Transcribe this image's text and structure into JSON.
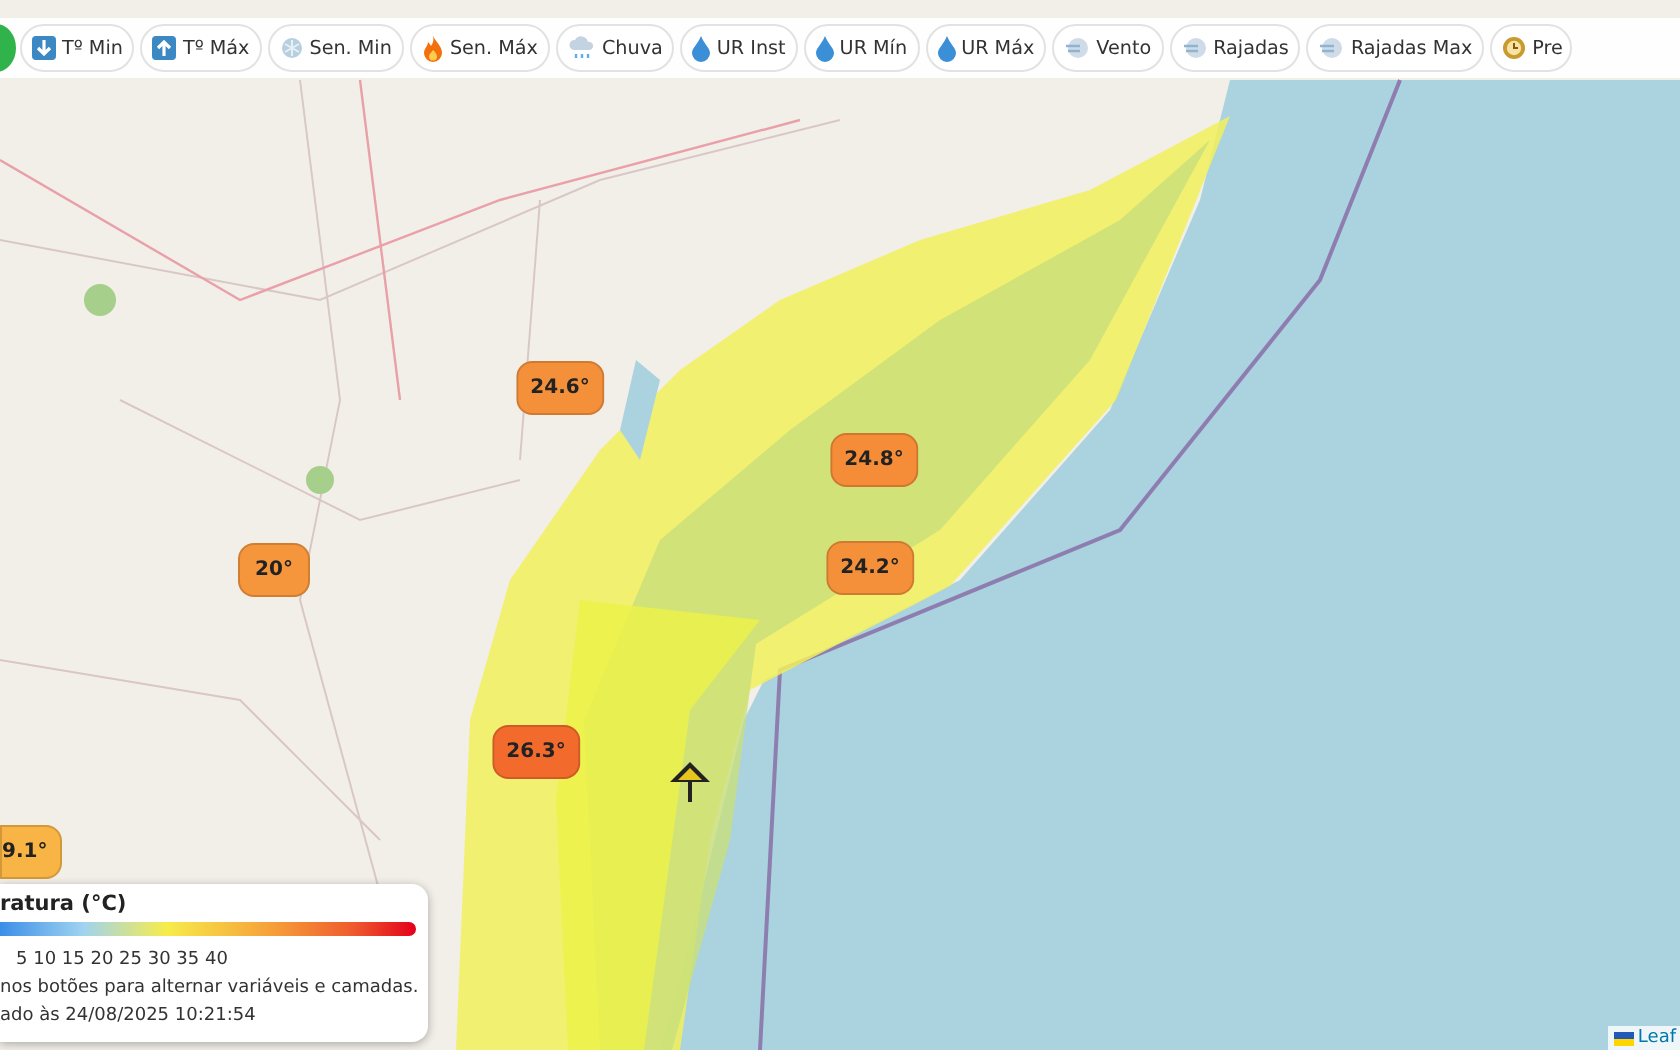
{
  "toolbar": {
    "buttons": [
      {
        "label": "Tº Min",
        "kind": "arrow-down"
      },
      {
        "label": "Tº Máx",
        "kind": "arrow-up"
      },
      {
        "label": "Sen. Min",
        "kind": "snow"
      },
      {
        "label": "Sen. Máx",
        "kind": "fire"
      },
      {
        "label": "Chuva",
        "kind": "rain"
      },
      {
        "label": "UR Inst",
        "kind": "drop"
      },
      {
        "label": "UR Mín",
        "kind": "drop"
      },
      {
        "label": "UR Máx",
        "kind": "drop"
      },
      {
        "label": "Vento",
        "kind": "wind"
      },
      {
        "label": "Rajadas",
        "kind": "wind"
      },
      {
        "label": "Rajadas Max",
        "kind": "wind"
      },
      {
        "label": "Pre",
        "kind": "clock"
      }
    ]
  },
  "markers": [
    {
      "label": "24.6°",
      "color": "#f5903a"
    },
    {
      "label": "24.8°",
      "color": "#f58c38"
    },
    {
      "label": "20°",
      "color": "#f5953c"
    },
    {
      "label": "24.2°",
      "color": "#f5903a"
    },
    {
      "label": "26.3°",
      "color": "#f26a2c"
    },
    {
      "label": "9.1°",
      "color": "#f8b444"
    }
  ],
  "legend": {
    "title": "ratura (°C)",
    "ticks": "5 10 15 20 25 30 35 40",
    "hint": "nos botões para alternar variáveis e camadas.",
    "updated": "ado às 24/08/2025 10:21:54"
  },
  "attribution": "Leaf"
}
